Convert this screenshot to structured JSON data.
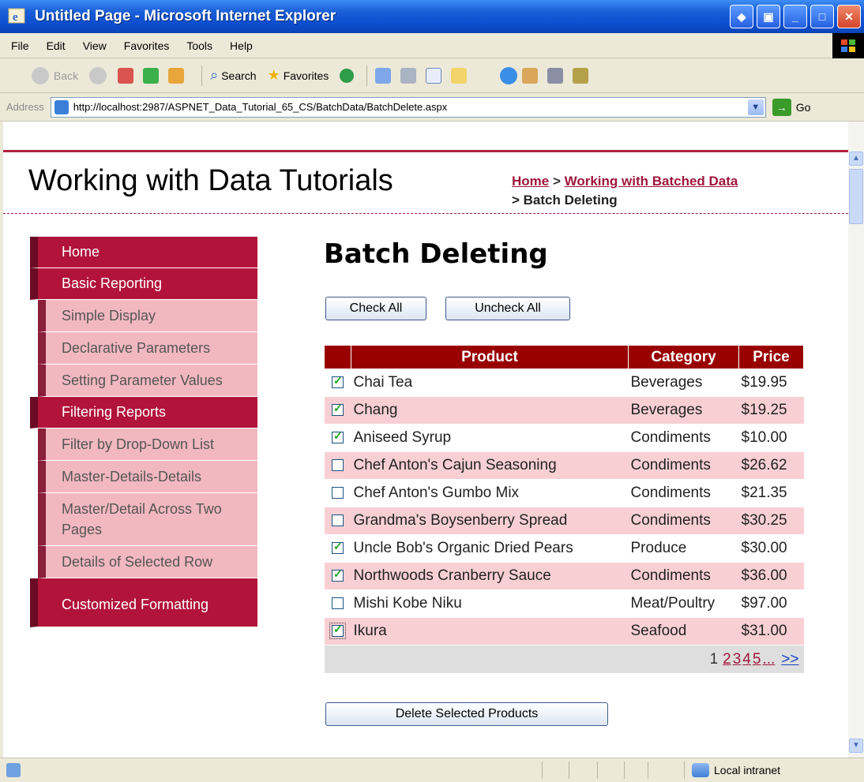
{
  "window": {
    "title": "Untitled Page - Microsoft Internet Explorer"
  },
  "menu": {
    "items": [
      "File",
      "Edit",
      "View",
      "Favorites",
      "Tools",
      "Help"
    ]
  },
  "toolbar": {
    "back_label": "Back",
    "search_label": "Search",
    "favorites_label": "Favorites"
  },
  "address": {
    "label": "Address",
    "url": "http://localhost:2987/ASPNET_Data_Tutorial_65_CS/BatchData/BatchDelete.aspx",
    "go_label": "Go"
  },
  "site": {
    "title": "Working with Data Tutorials"
  },
  "breadcrumb": {
    "home": "Home",
    "sep": " > ",
    "section": "Working with Batched Data",
    "current": "> Batch Deleting"
  },
  "sidebar": {
    "home": "Home",
    "basic_reporting": "Basic Reporting",
    "simple_display": "Simple Display",
    "declarative_parameters": "Declarative Parameters",
    "setting_parameter_values": "Setting Parameter Values",
    "filtering_reports": "Filtering Reports",
    "filter_dropdown": "Filter by Drop-Down List",
    "master_details": "Master-Details-Details",
    "master_detail_two_pages": "Master/Detail Across Two Pages",
    "details_selected_row": "Details of Selected Row",
    "customized_formatting": "Customized Formatting"
  },
  "main": {
    "title": "Batch Deleting",
    "check_all_label": "Check All",
    "uncheck_all_label": "Uncheck All",
    "delete_label": "Delete Selected Products"
  },
  "grid": {
    "headers": [
      "Product",
      "Category",
      "Price"
    ],
    "rows": [
      {
        "checked": true,
        "product": "Chai Tea",
        "category": "Beverages",
        "price": "$19.95"
      },
      {
        "checked": true,
        "product": "Chang",
        "category": "Beverages",
        "price": "$19.25"
      },
      {
        "checked": true,
        "product": "Aniseed Syrup",
        "category": "Condiments",
        "price": "$10.00"
      },
      {
        "checked": false,
        "product": "Chef Anton's Cajun Seasoning",
        "category": "Condiments",
        "price": "$26.62"
      },
      {
        "checked": false,
        "product": "Chef Anton's Gumbo Mix",
        "category": "Condiments",
        "price": "$21.35"
      },
      {
        "checked": false,
        "product": "Grandma's Boysenberry Spread",
        "category": "Condiments",
        "price": "$30.25"
      },
      {
        "checked": true,
        "product": "Uncle Bob's Organic Dried Pears",
        "category": "Produce",
        "price": "$30.00"
      },
      {
        "checked": true,
        "product": "Northwoods Cranberry Sauce",
        "category": "Condiments",
        "price": "$36.00"
      },
      {
        "checked": false,
        "product": "Mishi Kobe Niku",
        "category": "Meat/Poultry",
        "price": "$97.00"
      },
      {
        "checked": true,
        "product": "Ikura",
        "category": "Seafood",
        "price": "$31.00"
      }
    ],
    "pager": {
      "current": "1",
      "pages": [
        "2",
        "3",
        "4",
        "5"
      ],
      "ellipsis": "...",
      "next": ">>"
    }
  },
  "status": {
    "zone": "Local intranet"
  }
}
